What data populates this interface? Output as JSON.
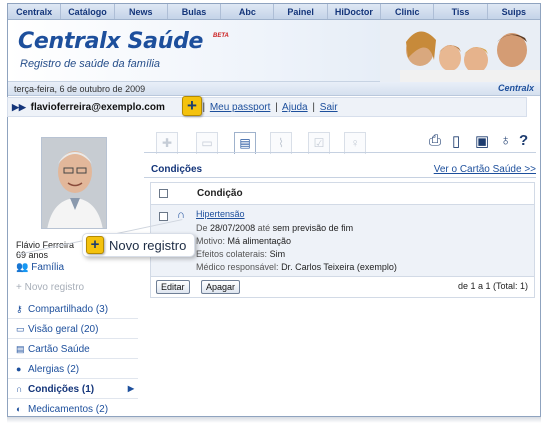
{
  "topnav": [
    "Centralx",
    "Catálogo",
    "News",
    "Bulas",
    "Abc",
    "Painel",
    "HiDoctor",
    "Clinic",
    "Tiss",
    "Suips"
  ],
  "banner": {
    "brand": "Centralx Saúde",
    "beta": "BETA",
    "tagline": "Registro de saúde da família",
    "date": "terça-feira, 6 de outubro de 2009",
    "logo_small": "Centralx"
  },
  "userbar": {
    "user": "flavioferreira@exemplo.com",
    "link_hidden": "Sair",
    "links": [
      "Meu passport",
      "Ajuda",
      "Sair"
    ]
  },
  "profile": {
    "name": "Flávio Ferreira",
    "age": "69 anos",
    "family_link": "Família",
    "novo_registro": "Novo registro"
  },
  "sidenav": [
    {
      "icon": "key-icon",
      "label": "Compartilhado (3)"
    },
    {
      "icon": "folder-icon",
      "label": "Visão geral (20)"
    },
    {
      "icon": "card-icon",
      "label": "Cartão Saúde"
    },
    {
      "icon": "drop-icon",
      "label": "Alergias (2)"
    },
    {
      "icon": "stethoscope-icon",
      "label": "Condições (1)",
      "active": true
    },
    {
      "icon": "pill-icon",
      "label": "Medicamentos (2)"
    }
  ],
  "content": {
    "section_title": "Condições",
    "ver_cartao": "Ver o Cartão Saúde >>",
    "column_header": "Condição",
    "row": {
      "name": "Hipertensão",
      "line1_label": "De",
      "line1_date": "28/07/2008",
      "line1_sep": "até",
      "line1_end": "sem previsão de fim",
      "motivo_label": "Motivo:",
      "motivo": "Má alimentação",
      "efeitos_label": "Efeitos colaterais:",
      "efeitos": "Sim",
      "medico_label": "Médico responsável:",
      "medico": "Dr. Carlos Teixeira (exemplo)"
    },
    "buttons": {
      "edit": "Editar",
      "delete": "Apagar"
    },
    "pager": "de 1 a 1 (Total: 1)"
  },
  "callout": {
    "label": "Novo registro",
    "plus": "+"
  },
  "colors": {
    "accent": "#1d4f9c",
    "badge": "#f4c20d"
  }
}
